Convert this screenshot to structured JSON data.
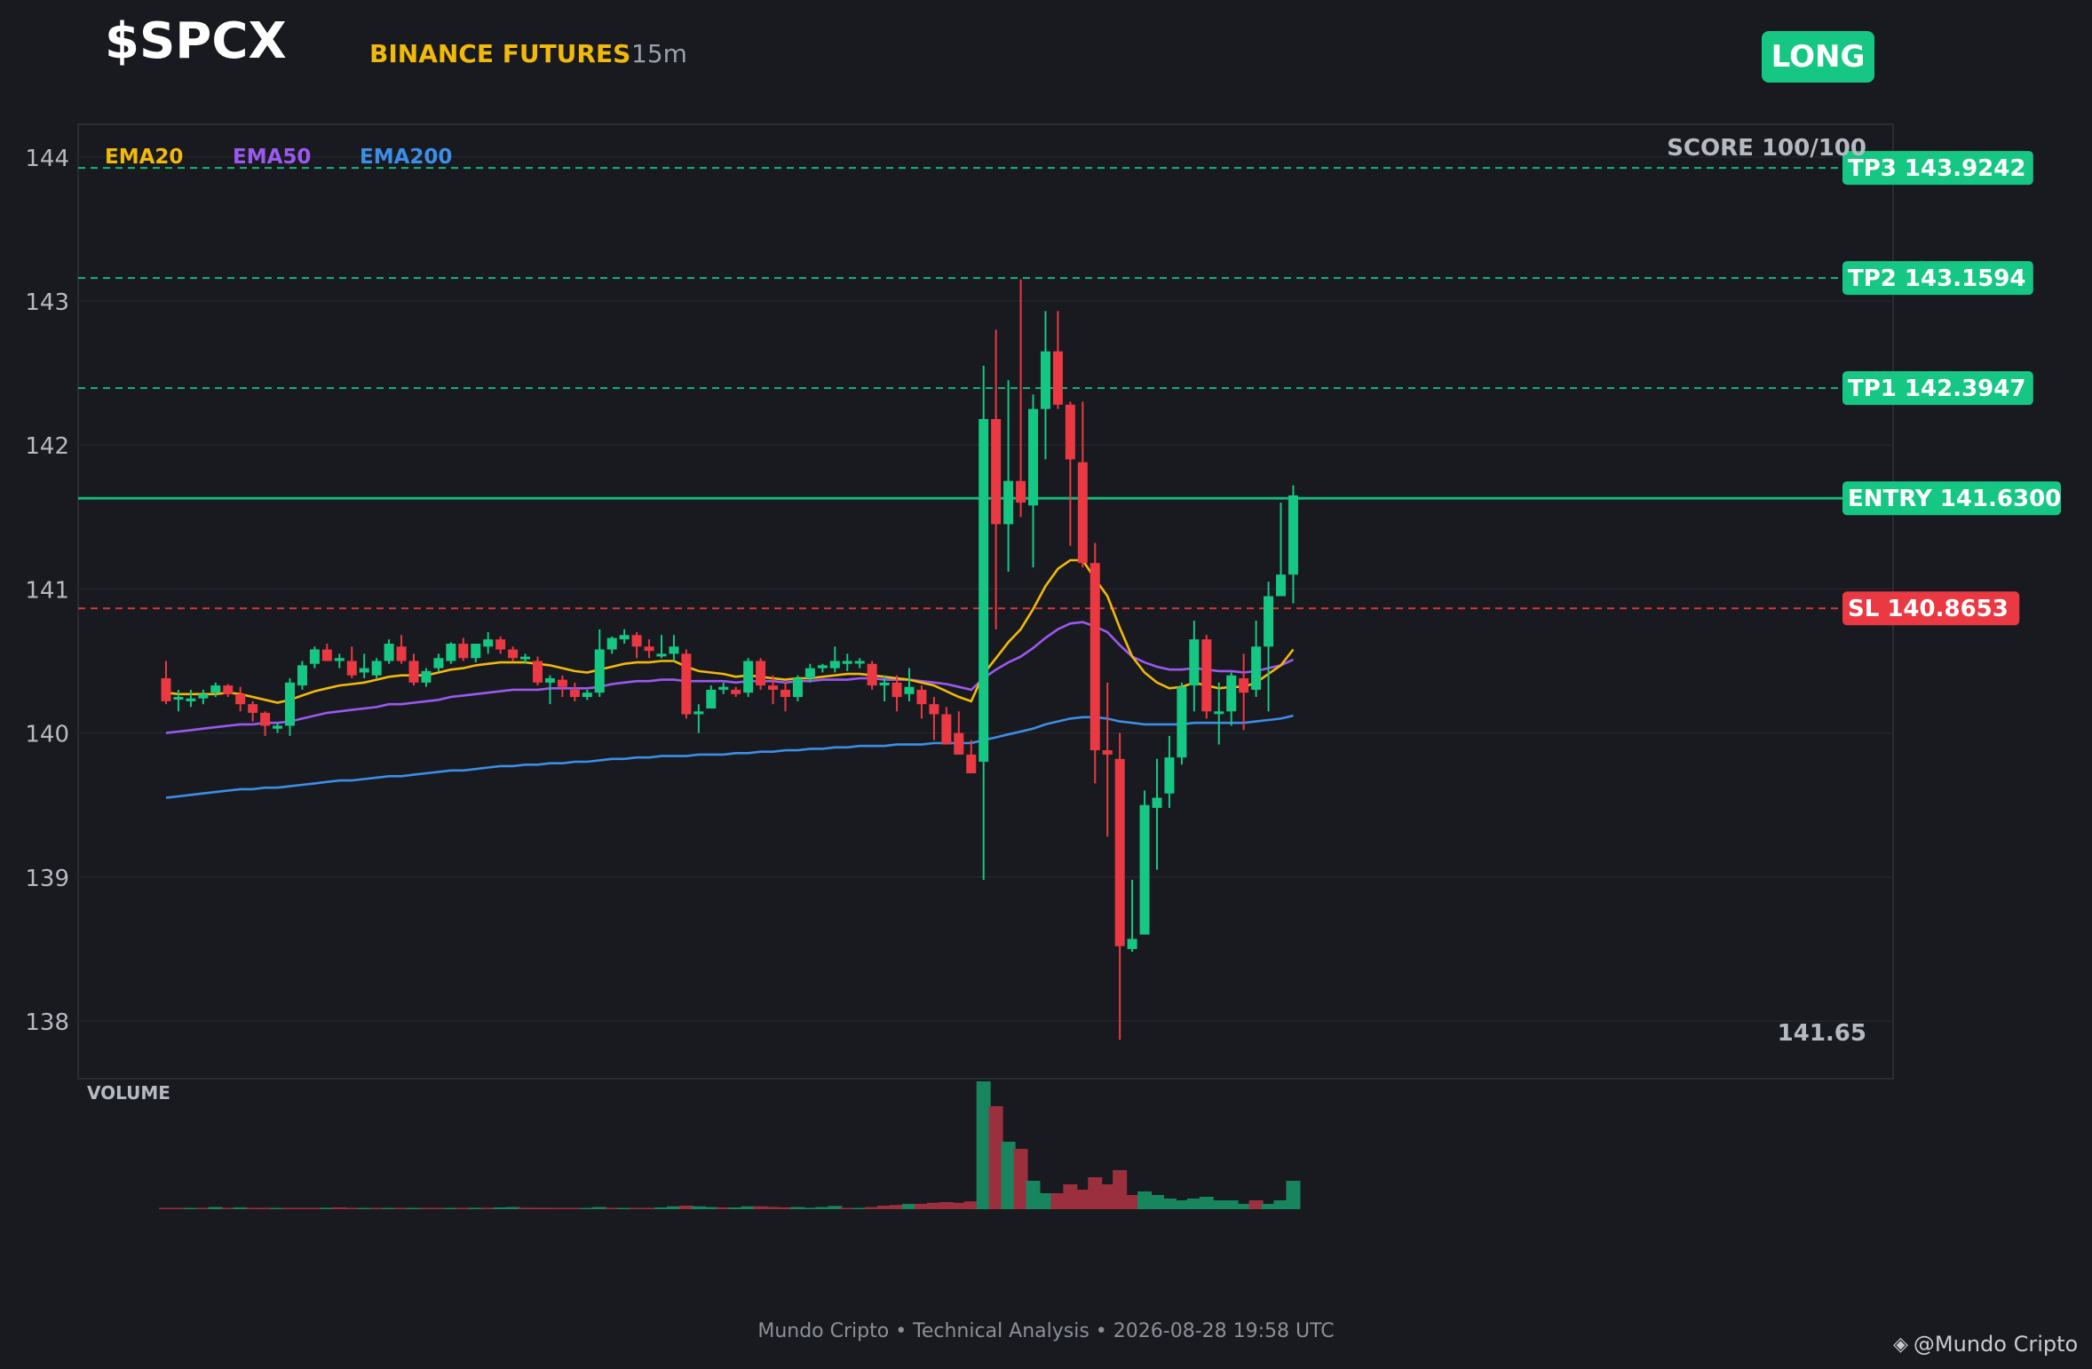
{
  "header": {
    "symbol": "$SPCX",
    "exchange": "BINANCE FUTURES",
    "timeframe": "15m",
    "signal": "LONG"
  },
  "colors": {
    "background": "#191a1f",
    "bull": "#16c784",
    "bear": "#ea3943",
    "ema20": "#f0b90b",
    "ema50": "#9b59f0",
    "ema200": "#3d8ee8",
    "grid": "#2a2c33"
  },
  "chart_data": {
    "type": "candlestick",
    "ylim": [
      137.6,
      144.2
    ],
    "yticks": [
      138,
      139,
      140,
      141,
      142,
      143,
      144
    ],
    "legend": [
      {
        "name": "EMA20",
        "color": "#f0b90b"
      },
      {
        "name": "EMA50",
        "color": "#9b59f0"
      },
      {
        "name": "EMA200",
        "color": "#3d8ee8"
      }
    ],
    "score_label": "SCORE 100/100",
    "last_price_label": "141.65",
    "volume_label": "VOLUME",
    "levels": [
      {
        "label": "TP3",
        "value": "143.9242",
        "price": 143.9242,
        "color": "#16c784"
      },
      {
        "label": "TP2",
        "value": "143.1594",
        "price": 143.1594,
        "color": "#16c784"
      },
      {
        "label": "TP1",
        "value": "142.3947",
        "price": 142.3947,
        "color": "#16c784"
      },
      {
        "label": "ENTRY",
        "value": "141.6300",
        "price": 141.63,
        "color": "#16c784"
      },
      {
        "label": "SL",
        "value": "140.8653",
        "price": 140.8653,
        "color": "#ea3943"
      }
    ],
    "candles": [
      [
        140.38,
        140.5,
        140.2,
        140.22
      ],
      [
        140.25,
        140.3,
        140.15,
        140.25
      ],
      [
        140.22,
        140.3,
        140.18,
        140.24
      ],
      [
        140.24,
        140.3,
        140.2,
        140.27
      ],
      [
        140.28,
        140.35,
        140.25,
        140.33
      ],
      [
        140.33,
        140.34,
        140.25,
        140.27
      ],
      [
        140.27,
        140.32,
        140.15,
        140.2
      ],
      [
        140.2,
        140.22,
        140.08,
        140.14
      ],
      [
        140.14,
        140.15,
        139.98,
        140.05
      ],
      [
        140.03,
        140.07,
        140.0,
        140.05
      ],
      [
        140.05,
        140.38,
        139.98,
        140.35
      ],
      [
        140.33,
        140.5,
        140.3,
        140.47
      ],
      [
        140.48,
        140.6,
        140.45,
        140.58
      ],
      [
        140.58,
        140.62,
        140.5,
        140.5
      ],
      [
        140.5,
        140.55,
        140.45,
        140.52
      ],
      [
        140.5,
        140.6,
        140.38,
        140.4
      ],
      [
        140.42,
        140.55,
        140.38,
        140.45
      ],
      [
        140.4,
        140.52,
        140.38,
        140.5
      ],
      [
        140.5,
        140.65,
        140.48,
        140.62
      ],
      [
        140.6,
        140.68,
        140.48,
        140.5
      ],
      [
        140.5,
        140.55,
        140.33,
        140.35
      ],
      [
        140.35,
        140.45,
        140.32,
        140.43
      ],
      [
        140.45,
        140.55,
        140.43,
        140.52
      ],
      [
        140.5,
        140.63,
        140.48,
        140.62
      ],
      [
        140.62,
        140.66,
        140.5,
        140.52
      ],
      [
        140.52,
        140.6,
        140.49,
        140.62
      ],
      [
        140.6,
        140.7,
        140.55,
        140.65
      ],
      [
        140.65,
        140.67,
        140.55,
        140.58
      ],
      [
        140.58,
        140.6,
        140.5,
        140.52
      ],
      [
        140.52,
        140.55,
        140.48,
        140.53
      ],
      [
        140.5,
        140.53,
        140.33,
        140.35
      ],
      [
        140.35,
        140.4,
        140.2,
        140.38
      ],
      [
        140.37,
        140.4,
        140.25,
        140.32
      ],
      [
        140.3,
        140.35,
        140.22,
        140.25
      ],
      [
        140.25,
        140.3,
        140.23,
        140.28
      ],
      [
        140.28,
        140.72,
        140.25,
        140.58
      ],
      [
        140.58,
        140.67,
        140.55,
        140.66
      ],
      [
        140.65,
        140.72,
        140.62,
        140.68
      ],
      [
        140.68,
        140.7,
        140.52,
        140.6
      ],
      [
        140.6,
        140.65,
        140.52,
        140.57
      ],
      [
        140.55,
        140.68,
        140.52,
        140.55
      ],
      [
        140.55,
        140.68,
        140.5,
        140.6
      ],
      [
        140.55,
        140.58,
        140.1,
        140.13
      ],
      [
        140.13,
        140.2,
        140.0,
        140.15
      ],
      [
        140.17,
        140.33,
        140.17,
        140.3
      ],
      [
        140.3,
        140.35,
        140.27,
        140.32
      ],
      [
        140.3,
        140.32,
        140.25,
        140.27
      ],
      [
        140.28,
        140.52,
        140.25,
        140.5
      ],
      [
        140.5,
        140.52,
        140.3,
        140.33
      ],
      [
        140.33,
        140.4,
        140.2,
        140.3
      ],
      [
        140.3,
        140.35,
        140.15,
        140.25
      ],
      [
        140.25,
        140.4,
        140.22,
        140.38
      ],
      [
        140.38,
        140.48,
        140.35,
        140.45
      ],
      [
        140.45,
        140.48,
        140.42,
        140.47
      ],
      [
        140.45,
        140.6,
        140.42,
        140.5
      ],
      [
        140.48,
        140.55,
        140.43,
        140.5
      ],
      [
        140.5,
        140.52,
        140.45,
        140.5
      ],
      [
        140.48,
        140.5,
        140.3,
        140.33
      ],
      [
        140.33,
        140.4,
        140.22,
        140.35
      ],
      [
        140.35,
        140.4,
        140.15,
        140.25
      ],
      [
        140.27,
        140.45,
        140.22,
        140.32
      ],
      [
        140.3,
        140.33,
        140.1,
        140.2
      ],
      [
        140.2,
        140.25,
        139.95,
        140.13
      ],
      [
        140.13,
        140.18,
        139.98,
        139.92
      ],
      [
        140.0,
        140.15,
        139.85,
        139.85
      ],
      [
        139.85,
        139.95,
        139.75,
        139.72
      ],
      [
        139.8,
        142.55,
        138.98,
        142.18
      ],
      [
        142.18,
        142.8,
        140.72,
        141.45
      ],
      [
        141.45,
        142.45,
        141.12,
        141.75
      ],
      [
        141.75,
        143.15,
        141.5,
        141.6
      ],
      [
        141.58,
        142.35,
        141.15,
        142.25
      ],
      [
        142.25,
        142.93,
        141.9,
        142.65
      ],
      [
        142.65,
        142.93,
        142.25,
        142.28
      ],
      [
        142.28,
        142.3,
        141.3,
        141.9
      ],
      [
        141.88,
        142.3,
        141.15,
        141.18
      ],
      [
        141.18,
        141.32,
        139.65,
        139.88
      ],
      [
        139.88,
        140.35,
        139.28,
        139.85
      ],
      [
        139.82,
        140.0,
        137.87,
        138.52
      ],
      [
        138.5,
        138.98,
        138.48,
        138.57
      ],
      [
        138.6,
        139.6,
        138.6,
        139.5
      ],
      [
        139.48,
        139.82,
        139.05,
        139.55
      ],
      [
        139.58,
        139.98,
        139.48,
        139.83
      ],
      [
        139.83,
        140.35,
        139.78,
        140.32
      ],
      [
        140.33,
        140.78,
        140.15,
        140.65
      ],
      [
        140.65,
        140.68,
        140.1,
        140.15
      ],
      [
        140.15,
        140.35,
        139.92,
        140.15
      ],
      [
        140.15,
        140.42,
        140.05,
        140.4
      ],
      [
        140.38,
        140.55,
        140.02,
        140.28
      ],
      [
        140.3,
        140.78,
        140.25,
        140.6
      ],
      [
        140.6,
        141.05,
        140.15,
        140.95
      ],
      [
        140.95,
        141.6,
        140.95,
        141.1
      ],
      [
        141.1,
        141.72,
        140.9,
        141.65
      ]
    ],
    "ema20": [
      140.28,
      140.27,
      140.27,
      140.27,
      140.27,
      140.28,
      140.27,
      140.25,
      140.23,
      140.21,
      140.23,
      140.26,
      140.29,
      140.31,
      140.33,
      140.34,
      140.35,
      140.37,
      140.39,
      140.4,
      140.4,
      140.4,
      140.42,
      140.44,
      140.45,
      140.47,
      140.48,
      140.49,
      140.49,
      140.49,
      140.48,
      140.47,
      140.45,
      140.43,
      140.42,
      140.44,
      140.46,
      140.48,
      140.49,
      140.49,
      140.5,
      140.5,
      140.46,
      140.43,
      140.42,
      140.41,
      140.39,
      140.4,
      140.39,
      140.38,
      140.37,
      140.38,
      140.38,
      140.39,
      140.4,
      140.41,
      140.41,
      140.4,
      140.39,
      140.38,
      140.37,
      140.35,
      140.33,
      140.29,
      140.25,
      140.22,
      140.41,
      140.52,
      140.63,
      140.72,
      140.86,
      141.02,
      141.14,
      141.2,
      141.2,
      141.07,
      140.95,
      140.73,
      140.53,
      140.42,
      140.35,
      140.31,
      140.32,
      140.35,
      140.33,
      140.31,
      140.32,
      140.32,
      140.35,
      140.41,
      140.47,
      140.58
    ],
    "ema50": [
      140.0,
      140.01,
      140.02,
      140.03,
      140.04,
      140.05,
      140.06,
      140.06,
      140.07,
      140.07,
      140.08,
      140.1,
      140.12,
      140.14,
      140.15,
      140.16,
      140.17,
      140.18,
      140.2,
      140.2,
      140.21,
      140.22,
      140.23,
      140.25,
      140.26,
      140.27,
      140.28,
      140.29,
      140.3,
      140.3,
      140.3,
      140.31,
      140.31,
      140.31,
      140.31,
      140.32,
      140.34,
      140.35,
      140.36,
      140.36,
      140.37,
      140.37,
      140.36,
      140.36,
      140.36,
      140.36,
      140.35,
      140.36,
      140.36,
      140.36,
      140.35,
      140.36,
      140.36,
      140.37,
      140.37,
      140.37,
      140.38,
      140.38,
      140.37,
      140.37,
      140.37,
      140.36,
      140.35,
      140.34,
      140.32,
      140.3,
      140.38,
      140.44,
      140.49,
      140.53,
      140.59,
      140.66,
      140.72,
      140.76,
      140.77,
      140.74,
      140.7,
      140.61,
      140.53,
      140.49,
      140.46,
      140.44,
      140.44,
      140.45,
      140.44,
      140.43,
      140.43,
      140.42,
      140.43,
      140.45,
      140.47,
      140.51
    ],
    "ema200": [
      139.55,
      139.56,
      139.57,
      139.58,
      139.59,
      139.6,
      139.61,
      139.61,
      139.62,
      139.62,
      139.63,
      139.64,
      139.65,
      139.66,
      139.67,
      139.67,
      139.68,
      139.69,
      139.7,
      139.7,
      139.71,
      139.72,
      139.73,
      139.74,
      139.74,
      139.75,
      139.76,
      139.77,
      139.77,
      139.78,
      139.78,
      139.79,
      139.79,
      139.8,
      139.8,
      139.81,
      139.82,
      139.82,
      139.83,
      139.83,
      139.84,
      139.84,
      139.84,
      139.85,
      139.85,
      139.85,
      139.86,
      139.86,
      139.87,
      139.87,
      139.88,
      139.88,
      139.89,
      139.89,
      139.9,
      139.9,
      139.91,
      139.91,
      139.91,
      139.92,
      139.92,
      139.92,
      139.93,
      139.93,
      139.93,
      139.93,
      139.95,
      139.97,
      139.99,
      140.01,
      140.03,
      140.06,
      140.08,
      140.1,
      140.11,
      140.11,
      140.1,
      140.08,
      140.07,
      140.06,
      140.06,
      140.06,
      140.06,
      140.07,
      140.07,
      140.07,
      140.07,
      140.07,
      140.08,
      140.09,
      140.1,
      140.12
    ],
    "volume": [
      0.3,
      0.1,
      0.1,
      0.2,
      0.6,
      0.1,
      0.5,
      0.3,
      0.4,
      0.3,
      0.2,
      0.2,
      0.2,
      0.4,
      0.5,
      0.2,
      0.2,
      0.3,
      0.3,
      0.3,
      0.1,
      0.2,
      0.2,
      0.3,
      0.1,
      0.4,
      0.4,
      0.5,
      0.6,
      0.4,
      0.4,
      0.4,
      0.3,
      0.2,
      0.3,
      0.6,
      0.3,
      0.3,
      0.3,
      0.3,
      0.5,
      0.8,
      1.0,
      0.8,
      0.6,
      0.5,
      0.5,
      0.8,
      0.8,
      0.6,
      0.5,
      0.6,
      0.4,
      0.6,
      0.9,
      0.3,
      0.3,
      0.6,
      1.0,
      1.2,
      1.5,
      1.5,
      1.8,
      2.0,
      1.8,
      2.2,
      36,
      29,
      19,
      17,
      8,
      4.5,
      4.5,
      7,
      5.5,
      9,
      7,
      11,
      4,
      5,
      4,
      3,
      2.5,
      3,
      3.5,
      2.5,
      2.5,
      1.5,
      2.5,
      1.5,
      2.5,
      8
    ],
    "volume_bull": [
      0,
      0,
      1,
      0,
      1,
      0,
      1,
      0,
      0,
      1,
      0,
      0,
      0,
      1,
      0,
      0,
      1,
      0,
      1,
      0,
      1,
      0,
      0,
      1,
      0,
      1,
      0,
      1,
      1,
      0,
      0,
      0,
      0,
      0,
      1,
      1,
      0,
      1,
      0,
      0,
      1,
      1,
      0,
      1,
      1,
      0,
      1,
      1,
      0,
      0,
      0,
      1,
      1,
      1,
      1,
      0,
      1,
      0,
      0,
      0,
      1,
      0,
      0,
      0,
      0,
      0,
      1,
      0,
      1,
      0,
      1,
      1,
      0,
      0,
      0,
      0,
      0,
      0,
      0,
      1,
      1,
      1,
      1,
      1,
      1,
      1,
      1,
      1,
      0,
      1,
      1,
      1
    ]
  },
  "footer": "Mundo Cripto • Technical Analysis • 2026-08-28 19:58 UTC",
  "watermark": {
    "icon": "binance-diamond-icon",
    "glyph": "◈",
    "text": "@Mundo Cripto"
  }
}
